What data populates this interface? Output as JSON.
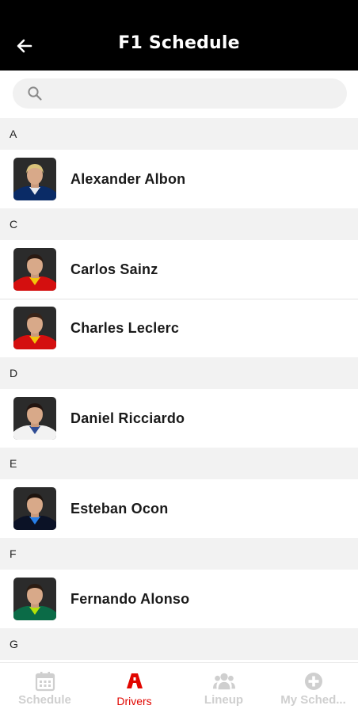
{
  "header": {
    "title": "F1 Schedule"
  },
  "search": {
    "placeholder": "",
    "value": ""
  },
  "sections": [
    {
      "letter": "A",
      "drivers": [
        {
          "name": "Alexander Albon",
          "suit": "#0a2b66",
          "accent": "#ffffff",
          "hair": "#d9c27a"
        }
      ]
    },
    {
      "letter": "C",
      "drivers": [
        {
          "name": "Carlos Sainz",
          "suit": "#d40f0f",
          "accent": "#f5d90a",
          "hair": "#2a1a12"
        },
        {
          "name": "Charles Leclerc",
          "suit": "#d40f0f",
          "accent": "#f5d90a",
          "hair": "#3a2418"
        }
      ]
    },
    {
      "letter": "D",
      "drivers": [
        {
          "name": "Daniel Ricciardo",
          "suit": "#f2f2f2",
          "accent": "#1a3a8a",
          "hair": "#231510"
        }
      ]
    },
    {
      "letter": "E",
      "drivers": [
        {
          "name": "Esteban Ocon",
          "suit": "#0b1226",
          "accent": "#2a8cff",
          "hair": "#1e140e"
        }
      ]
    },
    {
      "letter": "F",
      "drivers": [
        {
          "name": "Fernando Alonso",
          "suit": "#0b6b47",
          "accent": "#c8f000",
          "hair": "#2b1c12"
        }
      ]
    },
    {
      "letter": "G",
      "drivers": []
    }
  ],
  "tabs": [
    {
      "label": "Schedule",
      "icon": "calendar-icon",
      "active": false
    },
    {
      "label": "Drivers",
      "icon": "helmet-icon",
      "active": true
    },
    {
      "label": "Lineup",
      "icon": "group-icon",
      "active": false
    },
    {
      "label": "My Sched...",
      "icon": "plus-circle-icon",
      "active": false
    }
  ],
  "colors": {
    "accent": "#e10600",
    "header_bg": "#000000",
    "section_bg": "#f2f2f2",
    "inactive_tab": "#cfcfcf"
  }
}
